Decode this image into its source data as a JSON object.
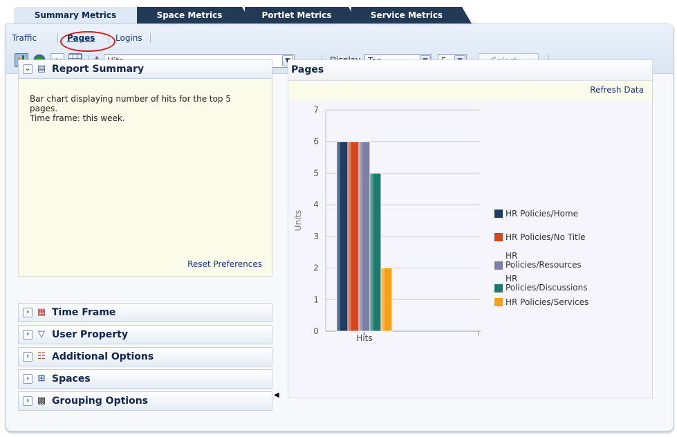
{
  "tabs": [
    {
      "label": "Summary Metrics",
      "active": true
    },
    {
      "label": "Space Metrics",
      "active": false
    },
    {
      "label": "Portlet Metrics",
      "active": false
    },
    {
      "label": "Service Metrics",
      "active": false
    }
  ],
  "subtabs": {
    "traffic": "Traffic",
    "pages": "Pages",
    "logins": "Logins"
  },
  "toolbar": {
    "required_marker": "*",
    "metric_value": "Hits",
    "display_label": "Display",
    "display_value": "Top",
    "count_value": "5",
    "select_button": "Select..."
  },
  "left_panel": {
    "report_summary_title": "Report Summary",
    "summary_text_1": "Bar chart displaying number of hits for the top 5 pages.",
    "summary_text_2": "Time frame: this week.",
    "reset_link": "Reset Preferences",
    "sections": [
      {
        "title": "Time Frame",
        "icon": "calendar-icon"
      },
      {
        "title": "User Property",
        "icon": "filter-icon"
      },
      {
        "title": "Additional Options",
        "icon": "checklist-icon"
      },
      {
        "title": "Spaces",
        "icon": "spaces-icon"
      },
      {
        "title": "Grouping Options",
        "icon": "grouping-icon"
      }
    ]
  },
  "chart_panel": {
    "title": "Pages",
    "refresh_link": "Refresh Data"
  },
  "chart_data": {
    "type": "bar",
    "categories": [
      "Hits",
      ""
    ],
    "ylabel": "Units",
    "ylim": [
      0,
      7
    ],
    "yticks": [
      0,
      1,
      2,
      3,
      4,
      5,
      6,
      7
    ],
    "grid": true,
    "legend_position": "right",
    "series": [
      {
        "name": "HR Policies/Home",
        "values": [
          6
        ],
        "color": "#1f3c66"
      },
      {
        "name": "HR Policies/No Title",
        "values": [
          6
        ],
        "color": "#d4471f"
      },
      {
        "name": "HR Policies/Resources",
        "values": [
          6
        ],
        "color": "#7d7fa6"
      },
      {
        "name": "HR Policies/Discussions",
        "values": [
          5
        ],
        "color": "#1e7a6e"
      },
      {
        "name": "HR Policies/Services",
        "values": [
          2
        ],
        "color": "#f5a11a"
      }
    ],
    "legend_labels": [
      [
        "HR Policies/Home"
      ],
      [
        "HR Policies/No Title"
      ],
      [
        "HR",
        "Policies/Resources"
      ],
      [
        "HR",
        "Policies/Discussions"
      ],
      [
        "HR Policies/Services"
      ]
    ]
  }
}
